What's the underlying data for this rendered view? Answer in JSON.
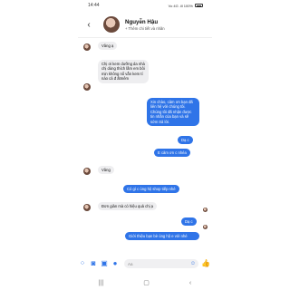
{
  "status_bar": {
    "time": "14:44",
    "right": "Vo 4G .ill 100%"
  },
  "header": {
    "contact_name": "Nguyễn Hậu",
    "contact_sub": "+ Thêm chi tiết và nhãn"
  },
  "messages": [
    {
      "dir": "in",
      "text": "Vâng ạ"
    },
    {
      "dir": "in",
      "text": "Chị ơi kem dưỡng da nhà chị dùng thích lắm em bôi mịn không nổ vẫn kem tí nào cả đ ấtmêm"
    },
    {
      "dir": "out",
      "text": "Xin chào, cảm ơn bạn đã liên hệ với chúng tôi. Chúng tôi đã nhận được tin nhắn của bạn và sẽ sớm trả lời."
    },
    {
      "dir": "out",
      "text": "Dạ c"
    },
    {
      "dir": "out",
      "text": "E cảm ơn c nhéa"
    },
    {
      "dir": "in",
      "text": "Vâng"
    },
    {
      "dir": "out",
      "text": "Có gì c ủng hộ shop tiếp nhé"
    },
    {
      "dir": "in",
      "text": "Đơn giản mà có hiệu quả chị ạ"
    },
    {
      "dir": "out",
      "text": "Dạ c"
    },
    {
      "dir": "out",
      "text": "Giới thiệu bạn bè ủng hộ e với nhé"
    }
  ],
  "composer": {
    "placeholder": "Aa"
  },
  "colors": {
    "accent": "#2f74e8",
    "bubble_in": "#eeeef0"
  },
  "icons": [
    "back-arrow-icon",
    "menu-icon",
    "camera-icon",
    "image-icon",
    "microphone-icon",
    "emoji-icon",
    "like-icon"
  ]
}
